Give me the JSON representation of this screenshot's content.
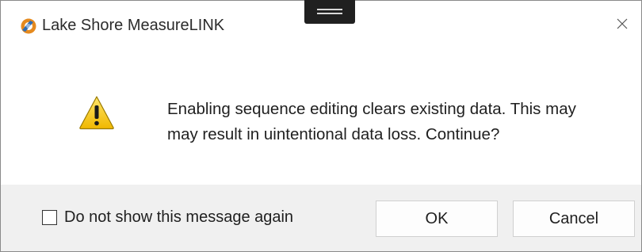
{
  "window": {
    "title": "Lake Shore MeasureLINK",
    "app_icon": "measurelink-app-icon",
    "close_icon": "close-icon"
  },
  "dialog": {
    "icon": "warning-icon",
    "message_line1": "Enabling sequence editing clears existing data. This may",
    "message_line2": "may result in uintentional data loss. Continue?"
  },
  "footer": {
    "checkbox_label": "Do not show this message again",
    "checkbox_checked": false,
    "ok_label": "OK",
    "cancel_label": "Cancel"
  },
  "colors": {
    "footer_background": "#f0f0f0",
    "warning_yellow": "#f2c200",
    "app_icon_orange": "#e58a1f",
    "app_icon_blue": "#2f6db5"
  }
}
